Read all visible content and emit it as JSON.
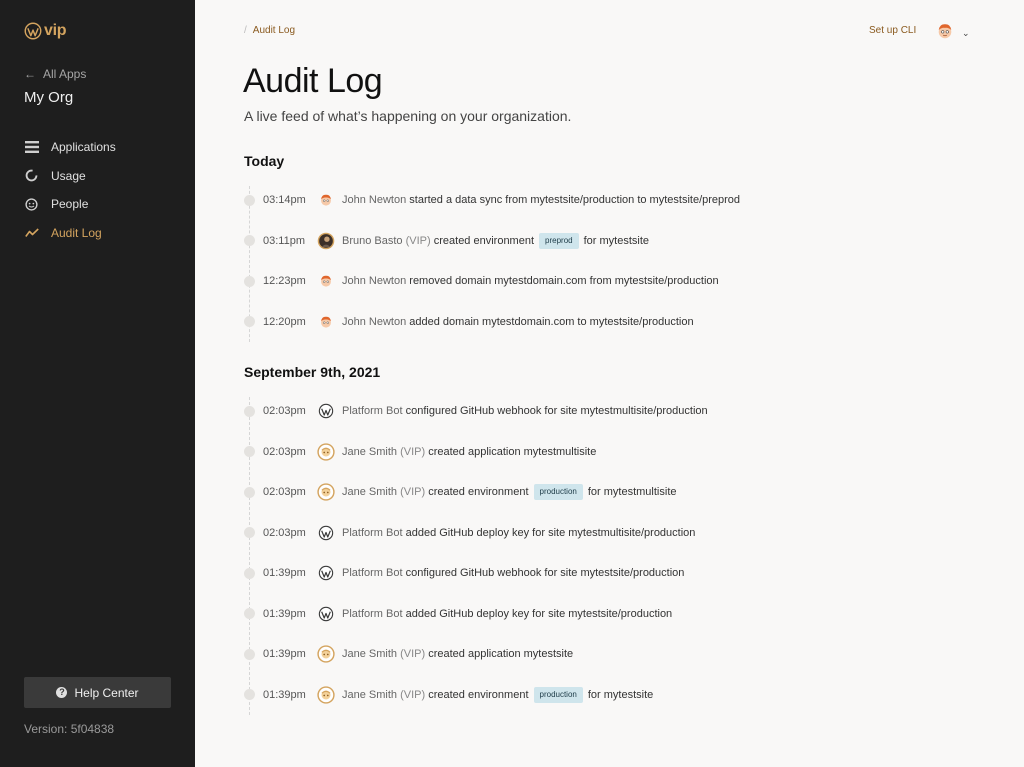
{
  "sidebar": {
    "logo_text": "vip",
    "back_label": "All Apps",
    "org_name": "My Org",
    "nav": [
      {
        "label": "Applications",
        "icon": "list-icon",
        "active": false
      },
      {
        "label": "Usage",
        "icon": "usage-ring-icon",
        "active": false
      },
      {
        "label": "People",
        "icon": "people-icon",
        "active": false
      },
      {
        "label": "Audit Log",
        "icon": "activity-icon",
        "active": true
      }
    ],
    "help_label": "Help Center",
    "version": "Version: 5f04838"
  },
  "header": {
    "breadcrumb": "Audit Log",
    "setup_cli": "Set up CLI"
  },
  "main": {
    "title": "Audit Log",
    "subtitle": "A live feed of what’s happening on your organization."
  },
  "sections": [
    {
      "title": "Today",
      "events": [
        {
          "time": "03:14pm",
          "avatar": "john-avatar",
          "actor": "John Newton",
          "vip": "",
          "pre": "started a data sync from mytestsite/production to mytestsite/preprod",
          "pill": "",
          "post": ""
        },
        {
          "time": "03:11pm",
          "avatar": "bruno-avatar",
          "actor": "Bruno Basto",
          "vip": "(VIP)",
          "pre": "created environment",
          "pill": "preprod",
          "post": "for mytestsite"
        },
        {
          "time": "12:23pm",
          "avatar": "john-avatar",
          "actor": "John Newton",
          "vip": "",
          "pre": "removed domain mytestdomain.com from mytestsite/production",
          "pill": "",
          "post": ""
        },
        {
          "time": "12:20pm",
          "avatar": "john-avatar",
          "actor": "John Newton",
          "vip": "",
          "pre": "added domain mytestdomain.com to mytestsite/production",
          "pill": "",
          "post": ""
        }
      ]
    },
    {
      "title": "September 9th, 2021",
      "events": [
        {
          "time": "02:03pm",
          "avatar": "wordpress-logo",
          "actor": "Platform Bot",
          "vip": "",
          "pre": "configured GitHub webhook for site mytestmultisite/production",
          "pill": "",
          "post": ""
        },
        {
          "time": "02:03pm",
          "avatar": "jane-avatar",
          "actor": "Jane Smith",
          "vip": "(VIP)",
          "pre": "created application mytestmultisite",
          "pill": "",
          "post": ""
        },
        {
          "time": "02:03pm",
          "avatar": "jane-avatar",
          "actor": "Jane Smith",
          "vip": "(VIP)",
          "pre": "created environment",
          "pill": "production",
          "post": "for mytestmultisite"
        },
        {
          "time": "02:03pm",
          "avatar": "wordpress-logo",
          "actor": "Platform Bot",
          "vip": "",
          "pre": "added GitHub deploy key for site mytestmultisite/production",
          "pill": "",
          "post": ""
        },
        {
          "time": "01:39pm",
          "avatar": "wordpress-logo",
          "actor": "Platform Bot",
          "vip": "",
          "pre": "configured GitHub webhook for site mytestsite/production",
          "pill": "",
          "post": ""
        },
        {
          "time": "01:39pm",
          "avatar": "wordpress-logo",
          "actor": "Platform Bot",
          "vip": "",
          "pre": "added GitHub deploy key for site mytestsite/production",
          "pill": "",
          "post": ""
        },
        {
          "time": "01:39pm",
          "avatar": "jane-avatar",
          "actor": "Jane Smith",
          "vip": "(VIP)",
          "pre": "created application mytestsite",
          "pill": "",
          "post": ""
        },
        {
          "time": "01:39pm",
          "avatar": "jane-avatar",
          "actor": "Jane Smith",
          "vip": "(VIP)",
          "pre": "created environment",
          "pill": "production",
          "post": "for mytestsite"
        }
      ]
    }
  ],
  "colors": {
    "sidebar_bg": "#1e1e1e",
    "accent": "#d4a45f",
    "page_bg": "#f9f8f7",
    "pill_bg": "#cfe5ec"
  }
}
